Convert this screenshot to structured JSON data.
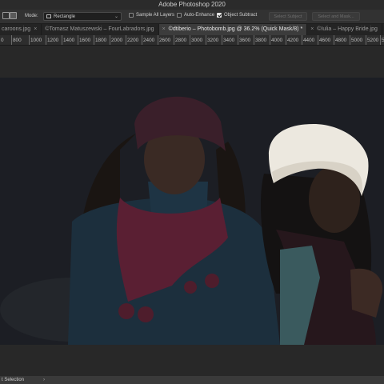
{
  "window": {
    "title": "Adobe Photoshop 2020"
  },
  "options_bar": {
    "mode_label": "Mode:",
    "mode_value": "Rectangle",
    "sample_all_layers": {
      "label": "Sample All Layers",
      "checked": false
    },
    "auto_enhance": {
      "label": "Auto-Enhance",
      "checked": false
    },
    "object_subtract": {
      "label": "Object Subtract",
      "checked": true
    },
    "select_subject_label": "Select Subject",
    "select_mask_label": "Select and Mask..."
  },
  "tabs": [
    {
      "label": "caroons.jpg",
      "active": false
    },
    {
      "label": "©Tomasz Matuszewski – FourLabradors.jpg",
      "active": false
    },
    {
      "label": "©dtiberio – Photobomb.jpg @ 36.2% (Quick Mask/8) *",
      "active": true
    },
    {
      "label": "©Iulia – Happy Bride.jpg",
      "active": false
    }
  ],
  "ruler": {
    "ticks": [
      "800",
      "1000",
      "1200",
      "1400",
      "1600",
      "1800",
      "2000",
      "2200",
      "2400",
      "2600",
      "2800",
      "3000",
      "3200",
      "3400",
      "3600",
      "3800",
      "4000",
      "4200",
      "4400",
      "4600",
      "4800",
      "5000",
      "5200",
      "5"
    ],
    "first_label": "0"
  },
  "status_bar": {
    "label": "t Selection",
    "arrow": "›"
  },
  "colors": {
    "ui_bg": "#282828",
    "toolbar": "#323232",
    "mask_overlay": "#1f2128",
    "hat_white": "#ece8df",
    "hat_plum": "#3a1f2a"
  },
  "icons": [
    "marquee-selection-icon",
    "new-selection-icon",
    "rectangle-mode-icon",
    "chevron-down-icon",
    "close-icon",
    "expand-arrow-icon"
  ]
}
